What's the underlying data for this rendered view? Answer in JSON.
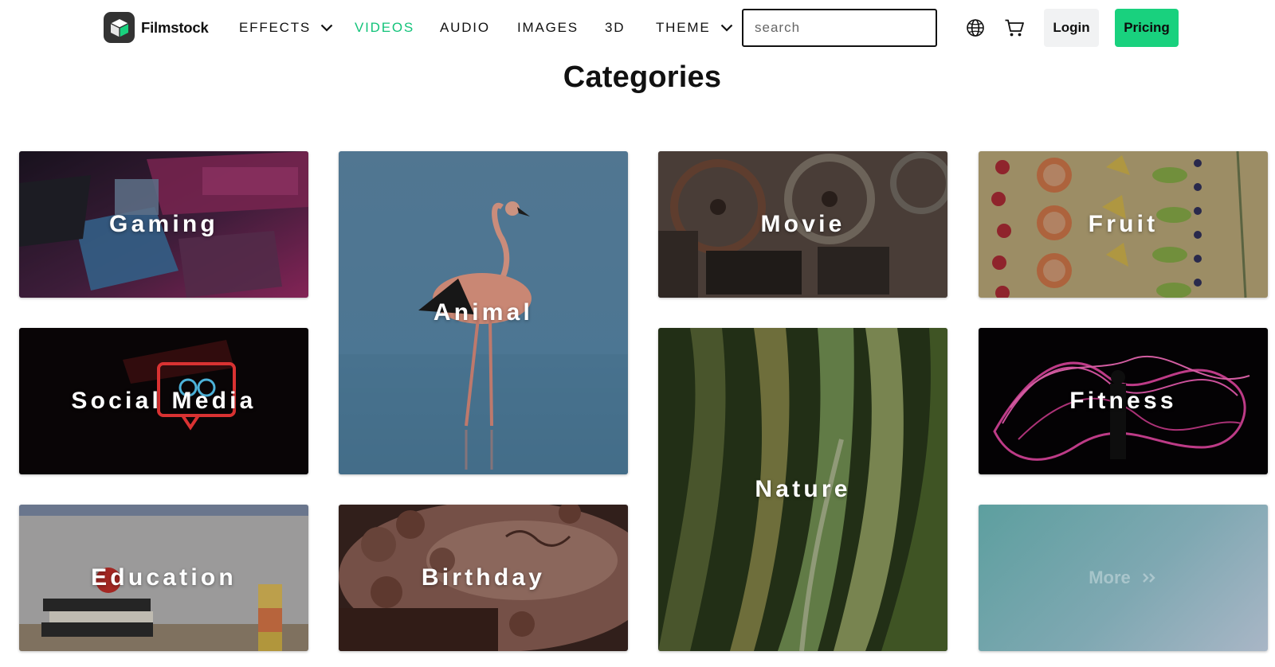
{
  "header": {
    "brand": "Filmstock",
    "nav": [
      {
        "label": "EFFECTS",
        "has_dropdown": true,
        "active": false
      },
      {
        "label": "VIDEOS",
        "has_dropdown": false,
        "active": true
      },
      {
        "label": "AUDIO",
        "has_dropdown": false,
        "active": false
      },
      {
        "label": "IMAGES",
        "has_dropdown": false,
        "active": false
      },
      {
        "label": "3D",
        "has_dropdown": false,
        "active": false
      },
      {
        "label": "THEME",
        "has_dropdown": true,
        "active": false
      }
    ],
    "search": {
      "placeholder": "search",
      "value": "",
      "button_icon": "search-icon"
    },
    "language_icon": "globe-icon",
    "cart_icon": "cart-icon",
    "login_label": "Login",
    "pricing_label": "Pricing"
  },
  "main": {
    "title": "Categories",
    "categories": [
      {
        "label": "Gaming"
      },
      {
        "label": "Animal"
      },
      {
        "label": "Movie"
      },
      {
        "label": "Fruit"
      },
      {
        "label": "Social Media"
      },
      {
        "label": "Nature"
      },
      {
        "label": "Fitness"
      },
      {
        "label": "Education"
      },
      {
        "label": "Birthday"
      }
    ],
    "more": {
      "label": "More",
      "icon": "double-chevron-right-icon"
    }
  },
  "colors": {
    "accent": "#19d17e",
    "active_nav": "#13c37a",
    "login_bg": "#f1f2f3",
    "text": "#111111"
  }
}
